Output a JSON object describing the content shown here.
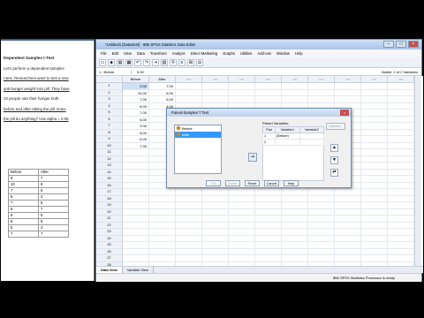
{
  "document": {
    "window_title": "Dependent samples t-test",
    "heading": "Dependent Samples t-Test",
    "lines": [
      "Let's perform a dependent samples",
      "t-test. Researchers want to test a new",
      "anti-hunger weight loss pill. They have",
      "10 people rate their hunger both",
      "before and after taking the pill. Does",
      "the pill do anything? Use alpha = 0.05"
    ],
    "table": {
      "headers": [
        "Before",
        "After"
      ],
      "rows": [
        [
          "9",
          "7"
        ],
        [
          "10",
          "6"
        ],
        [
          "7",
          "5"
        ],
        [
          "8",
          "4"
        ],
        [
          "7",
          "5"
        ],
        [
          "6",
          "7"
        ],
        [
          "9",
          "5"
        ],
        [
          "8",
          "6"
        ],
        [
          "6",
          "4"
        ],
        [
          "7",
          "7"
        ]
      ]
    }
  },
  "spss": {
    "window_title": "*Untitled1 [DataSet0] - IBM SPSS Statistics Data Editor",
    "menus": [
      "File",
      "Edit",
      "View",
      "Data",
      "Transform",
      "Analyze",
      "Direct Marketing",
      "Graphs",
      "Utilities",
      "Add-ons",
      "Window",
      "Help"
    ],
    "cell_ref": "1 : Before",
    "cell_value": "9.00",
    "visible_vars": "Visible: 2 of 2 Variables",
    "columns": [
      "Before",
      "After",
      "var",
      "var",
      "var",
      "var",
      "var",
      "var",
      "var",
      "var",
      "var"
    ],
    "rows": [
      [
        "9.00",
        "7.00"
      ],
      [
        "10.00",
        "6.00"
      ],
      [
        "7.00",
        "5.00"
      ],
      [
        "8.00",
        "4.00"
      ],
      [
        "7.00",
        "5.00"
      ],
      [
        "6.00",
        "7.00"
      ],
      [
        "9.00",
        "5.00"
      ],
      [
        "8.00",
        "6.00"
      ],
      [
        "6.00",
        "4.00"
      ],
      [
        "7.00",
        "7.00"
      ]
    ],
    "row_count": 30,
    "tabs": [
      "Data View",
      "Variable View"
    ],
    "status": "IBM SPSS Statistics Processor is ready"
  },
  "dialog": {
    "title": "Paired-Samples T Test",
    "variables": [
      "Before",
      "After"
    ],
    "paired_label": "Paired Variables:",
    "paired_headers": [
      "Pair",
      "Variable1",
      "Variable2"
    ],
    "paired_rows": [
      [
        "1",
        "[Before]",
        ""
      ],
      [
        "2",
        "",
        ""
      ]
    ],
    "options_label": "Options...",
    "buttons": [
      "OK",
      "Paste",
      "Reset",
      "Cancel",
      "Help"
    ]
  }
}
